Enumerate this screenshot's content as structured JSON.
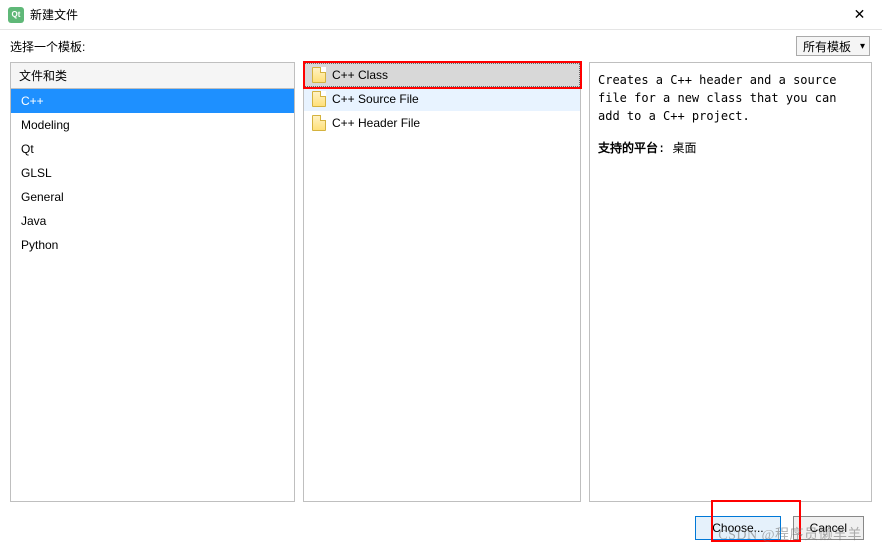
{
  "window": {
    "title": "新建文件",
    "subtitle": "选择一个模板:"
  },
  "filter": {
    "label": "所有模板"
  },
  "categories": {
    "header": "文件和类",
    "items": [
      {
        "label": "C++",
        "selected": true
      },
      {
        "label": "Modeling",
        "selected": false
      },
      {
        "label": "Qt",
        "selected": false
      },
      {
        "label": "GLSL",
        "selected": false
      },
      {
        "label": "General",
        "selected": false
      },
      {
        "label": "Java",
        "selected": false
      },
      {
        "label": "Python",
        "selected": false
      }
    ]
  },
  "templates": {
    "items": [
      {
        "label": "C++ Class",
        "selected": true
      },
      {
        "label": "C++ Source File",
        "selected": false
      },
      {
        "label": "C++ Header File",
        "selected": false
      }
    ]
  },
  "details": {
    "description": "Creates a C++ header and a source file for a new class that you can add to a C++ project.",
    "platform_label": "支持的平台",
    "platform_value": "桌面"
  },
  "buttons": {
    "choose": "Choose...",
    "cancel": "Cancel"
  },
  "watermark": "CSDN @程序员懒羊羊"
}
